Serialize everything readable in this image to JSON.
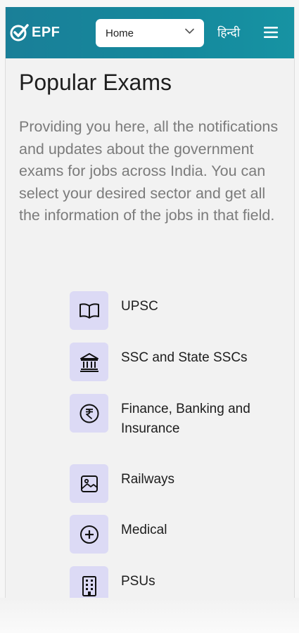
{
  "header": {
    "logo_text": "EPF",
    "logo_icon": "check-circle-icon",
    "nav_select": {
      "value": "Home"
    },
    "language_label": "हिन्दी",
    "menu_icon": "hamburger-menu-icon",
    "background_color": "#14899d"
  },
  "main": {
    "title": "Popular Exams",
    "description": "Providing you here, all the notifications and updates about the government exams for jobs across India. You can select your desired sector and get all the information of the jobs in that field."
  },
  "exams": [
    {
      "label": "UPSC",
      "icon": "book-open-icon"
    },
    {
      "label": "SSC and State SSCs",
      "icon": "bank-building-icon"
    },
    {
      "label": "Finance, Banking and Insurance",
      "icon": "rupee-coin-icon"
    },
    {
      "label": "Railways",
      "icon": "image-frame-icon"
    },
    {
      "label": "Medical",
      "icon": "plus-circle-icon"
    },
    {
      "label": "PSUs",
      "icon": "office-building-icon"
    }
  ],
  "colors": {
    "icon_tile": "#dcdaf5",
    "description_text": "#7b7b7b"
  }
}
